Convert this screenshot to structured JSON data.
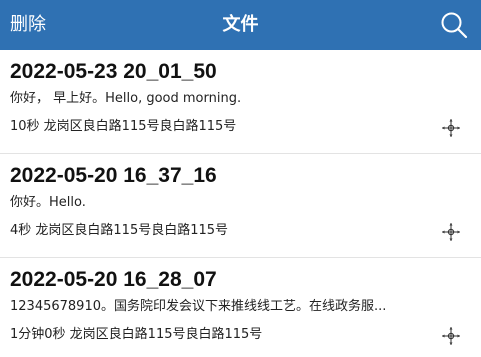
{
  "navbar": {
    "left_label": "删除",
    "title": "文件",
    "search_icon": "search-icon"
  },
  "items": [
    {
      "title": "2022-05-23 20_01_50",
      "text": "你好， 早上好。Hello, good morning.",
      "meta": "10秒 龙岗区良白路115号良白路115号",
      "icon": "move-icon"
    },
    {
      "title": "2022-05-20 16_37_16",
      "text": "你好。Hello.",
      "meta": "4秒 龙岗区良白路115号良白路115号",
      "icon": "move-icon"
    },
    {
      "title": "2022-05-20 16_28_07",
      "text": "12345678910。国务院印发会议下来推线线工艺。在线政务服...",
      "meta": "1分钟0秒 龙岗区良白路115号良白路115号",
      "icon": "move-icon"
    }
  ],
  "colors": {
    "navbar_bg": "#2f71b3",
    "navbar_text": "#ffffff",
    "divider": "#e3e3e3"
  }
}
